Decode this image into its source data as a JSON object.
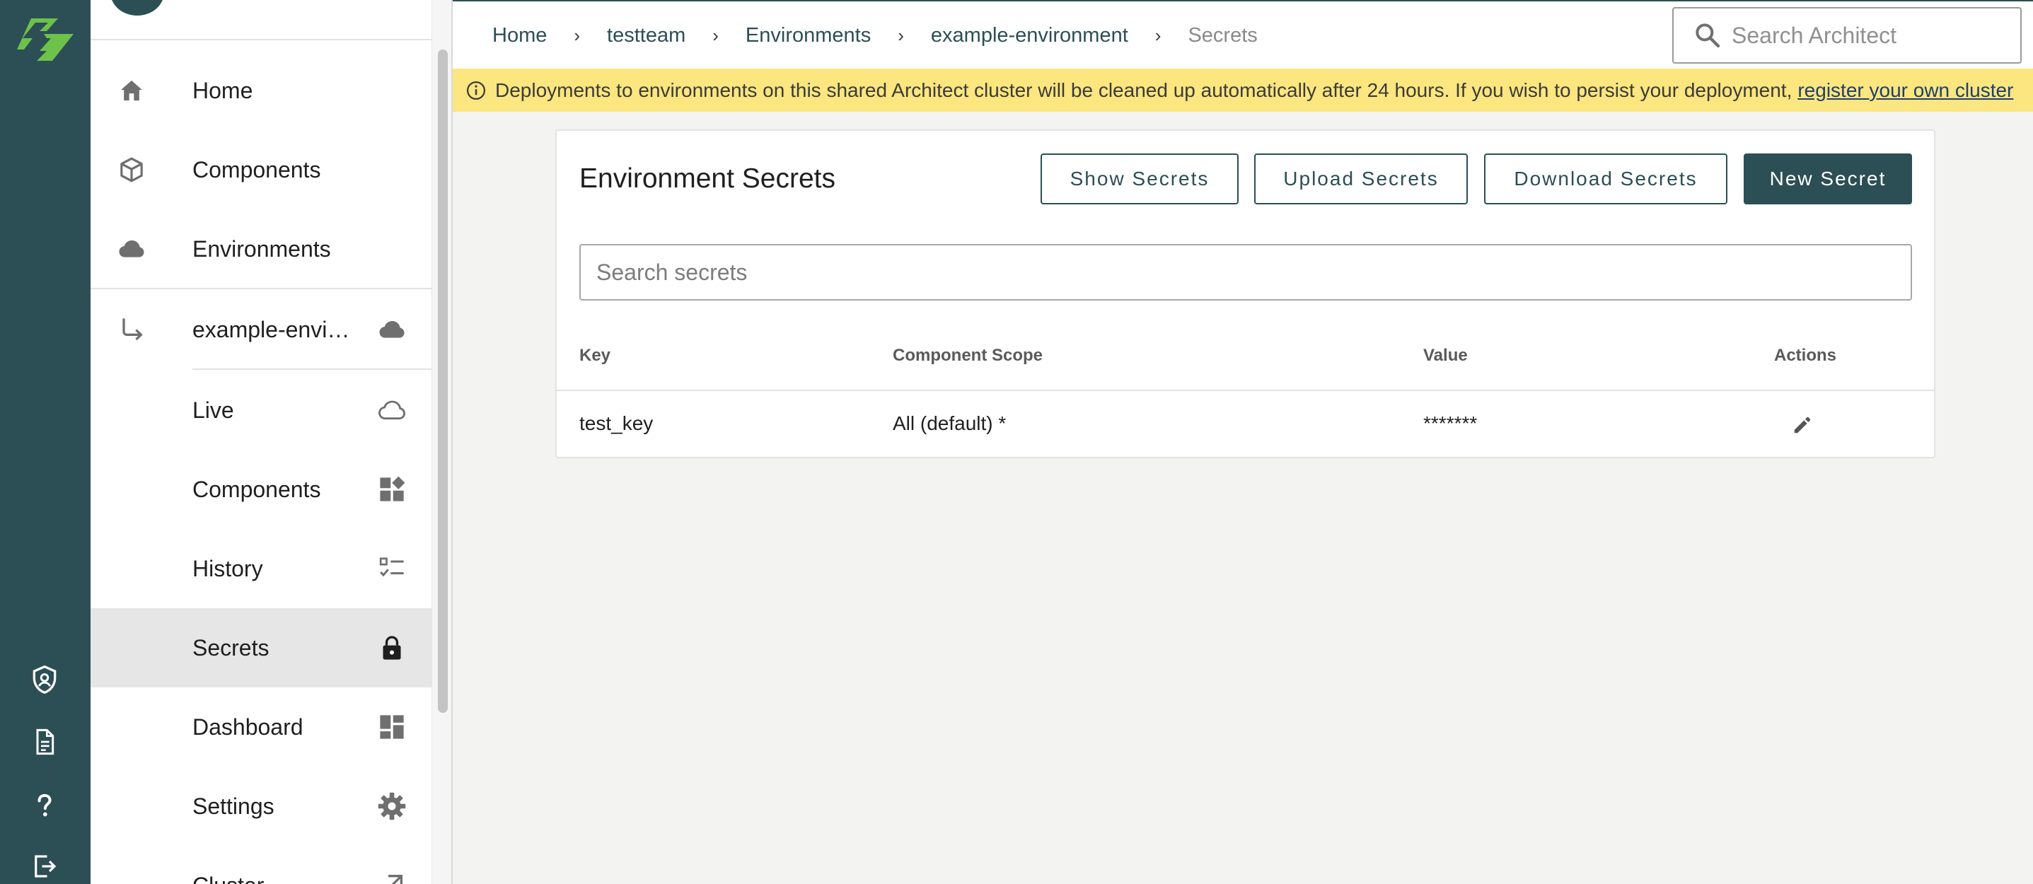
{
  "rail": {
    "icons": [
      "architect-logo",
      "shield-user-icon",
      "document-icon",
      "help-icon",
      "logout-icon"
    ]
  },
  "sidebar": {
    "items": [
      {
        "label": "Home",
        "icon": "home-icon"
      },
      {
        "label": "Components",
        "icon": "cube-icon"
      },
      {
        "label": "Environments",
        "icon": "cloud-icon"
      },
      {
        "label": "example-environment",
        "icon": "subdirectory-arrow-icon",
        "trail_icon": "cloud-icon"
      },
      {
        "label": "Live",
        "icon": "cloud-outline-icon"
      },
      {
        "label": "Components",
        "icon": "widgets-icon"
      },
      {
        "label": "History",
        "icon": "checklist-icon"
      },
      {
        "label": "Secrets",
        "icon": "lock-icon",
        "active": true
      },
      {
        "label": "Dashboard",
        "icon": "dashboard-icon"
      },
      {
        "label": "Settings",
        "icon": "gear-icon"
      },
      {
        "label": "Cluster",
        "icon": "external-link-icon"
      }
    ]
  },
  "header": {
    "breadcrumbs": [
      "Home",
      "testteam",
      "Environments",
      "example-environment",
      "Secrets"
    ],
    "search_placeholder": "Search Architect"
  },
  "banner": {
    "text": "Deployments to environments on this shared Architect cluster will be cleaned up automatically after 24 hours. If you wish to persist your deployment,",
    "link": "register your own cluster"
  },
  "secrets_card": {
    "title": "Environment Secrets",
    "buttons": {
      "show": "Show Secrets",
      "upload": "Upload Secrets",
      "download": "Download Secrets",
      "new": "New Secret"
    },
    "search_placeholder": "Search secrets",
    "columns": [
      "Key",
      "Component Scope",
      "Value",
      "Actions"
    ],
    "rows": [
      {
        "key": "test_key",
        "scope": "All (default) *",
        "value": "*******",
        "action_icon": "edit-icon"
      }
    ]
  },
  "colors": {
    "brand": "#2c4e55",
    "logo_green": "#6cc24a",
    "banner": "#fbe67f",
    "active_item": "#e6e6e6"
  }
}
